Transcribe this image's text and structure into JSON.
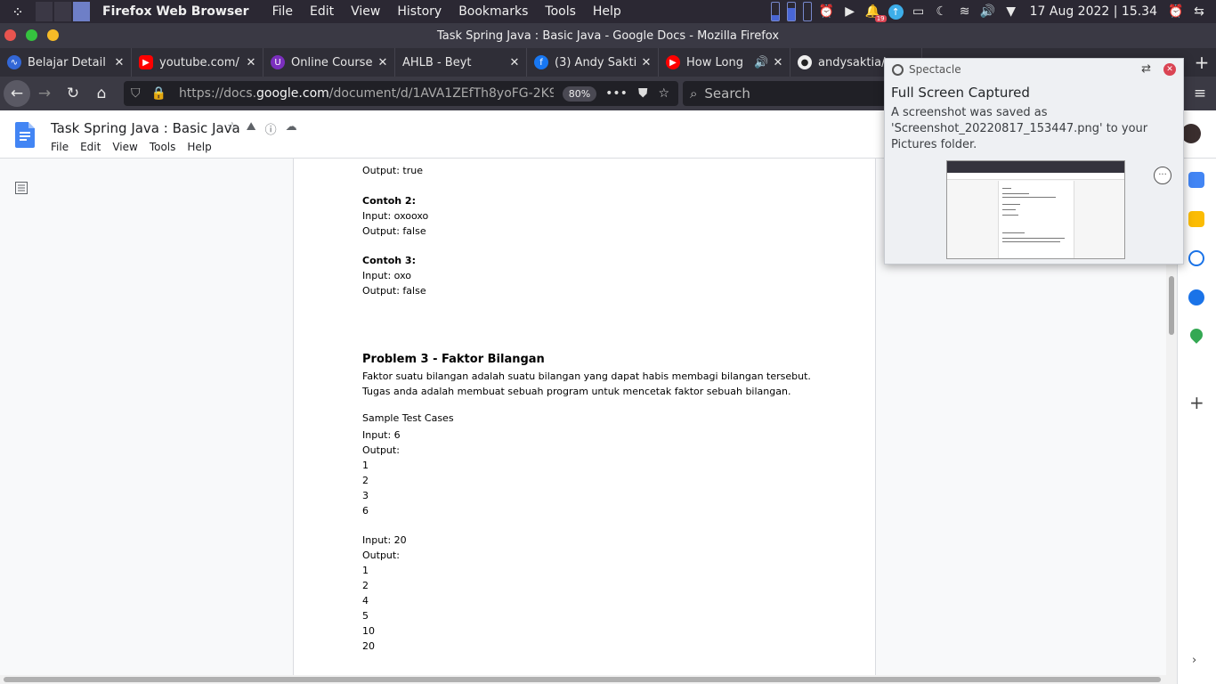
{
  "system_bar": {
    "app_name": "Firefox Web Browser",
    "menus": [
      "File",
      "Edit",
      "View",
      "History",
      "Bookmarks",
      "Tools",
      "Help"
    ],
    "notification_count": "19",
    "datetime": "17 Aug 2022 | 15.34"
  },
  "window": {
    "title": "Task Spring Java : Basic Java - Google Docs - Mozilla Firefox"
  },
  "tabs": [
    {
      "label": "Belajar Detail",
      "color": "#3367d6"
    },
    {
      "label": "youtube.com/",
      "color": "#ff0000"
    },
    {
      "label": "Online Course",
      "color": "#7b2fbe"
    },
    {
      "label": "AHLB - Beyt",
      "color": ""
    },
    {
      "label": "(3) Andy Sakti",
      "color": "#1877f2"
    },
    {
      "label": "How Long",
      "color": "#ff0000"
    },
    {
      "label": "andysaktia/",
      "color": "#222222"
    }
  ],
  "navbar": {
    "url_prefix": "https://docs.",
    "url_host": "google.com",
    "url_path": "/document/d/1AVA1ZEfTh8yoFG-2K9",
    "zoom": "80%",
    "search_placeholder": "Search"
  },
  "docs": {
    "title": "Task Spring Java : Basic Java",
    "menu": [
      "File",
      "Edit",
      "View",
      "Tools",
      "Help"
    ]
  },
  "document": {
    "lines": [
      {
        "text": "Output: true",
        "style": "normal"
      },
      {
        "text": "Contoh 2:",
        "style": "bold"
      },
      {
        "text": "Input: oxooxo",
        "style": "normal"
      },
      {
        "text": "Output: false",
        "style": "normal"
      },
      {
        "text": "Contoh 3:",
        "style": "bold"
      },
      {
        "text": "Input: oxo",
        "style": "normal"
      },
      {
        "text": "Output: false",
        "style": "normal"
      },
      {
        "text": "Problem 3 - Faktor Bilangan",
        "style": "heading"
      },
      {
        "text": "Faktor suatu bilangan adalah suatu bilangan yang dapat habis membagi bilangan tersebut.",
        "style": "normal"
      },
      {
        "text": "Tugas anda adalah membuat sebuah program untuk mencetak faktor sebuah bilangan.",
        "style": "normal"
      },
      {
        "text": "Sample Test Cases",
        "style": "normal"
      },
      {
        "text": "Input: 6",
        "style": "normal"
      },
      {
        "text": "Output:",
        "style": "normal"
      },
      {
        "text": "1",
        "style": "normal"
      },
      {
        "text": "2",
        "style": "normal"
      },
      {
        "text": "3",
        "style": "normal"
      },
      {
        "text": "6",
        "style": "normal"
      },
      {
        "text": "Input: 20",
        "style": "normal"
      },
      {
        "text": "Output:",
        "style": "normal"
      },
      {
        "text": "1",
        "style": "normal"
      },
      {
        "text": "2",
        "style": "normal"
      },
      {
        "text": "4",
        "style": "normal"
      },
      {
        "text": "5",
        "style": "normal"
      },
      {
        "text": "10",
        "style": "normal"
      },
      {
        "text": "20",
        "style": "normal"
      }
    ]
  },
  "notification": {
    "app": "Spectacle",
    "title": "Full Screen Captured",
    "body": "A screenshot was saved as 'Screenshot_20220817_153447.png' to your Pictures folder."
  }
}
